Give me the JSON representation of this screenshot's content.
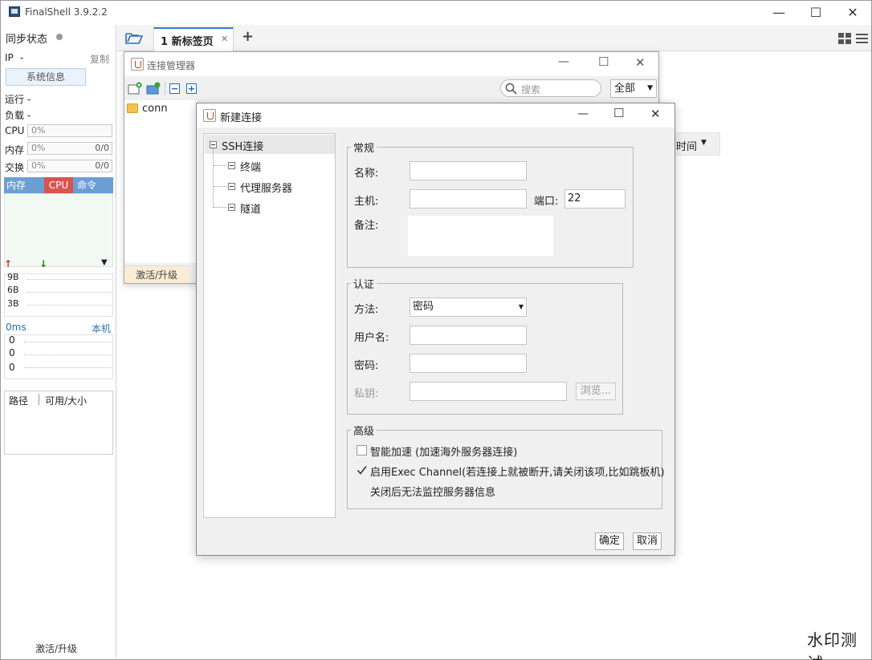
{
  "app": {
    "title": "FinalShell 3.9.2.2",
    "min": "—",
    "max": "☐",
    "close": "✕"
  },
  "sidebar": {
    "sync_label": "同步状态",
    "ip_label": "IP",
    "ip_value": "-",
    "copy": "复制",
    "sysinfo": "系统信息",
    "run_label": "运行 -",
    "load_label": "负载 -",
    "cpu_label": "CPU",
    "cpu_val": "0%",
    "mem_label": "内存",
    "mem_val": "0%",
    "mem_right": "0/0",
    "swap_label": "交换",
    "swap_val": "0%",
    "swap_right": "0/0",
    "proc_tabs": [
      "内存",
      "CPU",
      "命令"
    ],
    "net_up": "↑",
    "net_down": "↓",
    "net_menu": "▼",
    "net_ticks": [
      "9B",
      "6B",
      "3B"
    ],
    "ping_label": "0ms",
    "ping_host": "本机",
    "ping_ticks": [
      "0",
      "0",
      "0"
    ],
    "path_col": "路径",
    "size_col": "可用/大小",
    "activate": "激活/升级"
  },
  "tabs": {
    "folder_icon": "folder-open-icon",
    "tab1_label": "1 新标签页",
    "tab1_close": "✕",
    "add": "+",
    "grid_icon": "grid-icon",
    "menu_icon": "hamburger-icon"
  },
  "conn_manager": {
    "title": "连接管理器",
    "search_placeholder": "搜索",
    "filter": "全部",
    "items": [
      "conn"
    ],
    "activate": "激活/升级",
    "time_col": "时间"
  },
  "new_conn": {
    "title": "新建连接",
    "tree": {
      "root": "SSH连接",
      "children": [
        "终端",
        "代理服务器",
        "隧道"
      ]
    },
    "general": {
      "legend": "常规",
      "name_label": "名称:",
      "name_value": "",
      "host_label": "主机:",
      "host_value": "",
      "port_label": "端口:",
      "port_value": "22",
      "remark_label": "备注:"
    },
    "auth": {
      "legend": "认证",
      "method_label": "方法:",
      "method_value": "密码",
      "user_label": "用户名:",
      "pass_label": "密码:",
      "key_label": "私钥:",
      "browse": "浏览..."
    },
    "advanced": {
      "legend": "高级",
      "smart_accel": "智能加速 (加速海外服务器连接)",
      "smart_accel_checked": false,
      "exec_channel": "启用Exec Channel(若连接上就被断开,请关闭该项,比如跳板机)",
      "exec_channel_checked": true,
      "exec_note": "关闭后无法监控服务器信息"
    },
    "ok": "确定",
    "cancel": "取消"
  },
  "watermark": "水印测试"
}
